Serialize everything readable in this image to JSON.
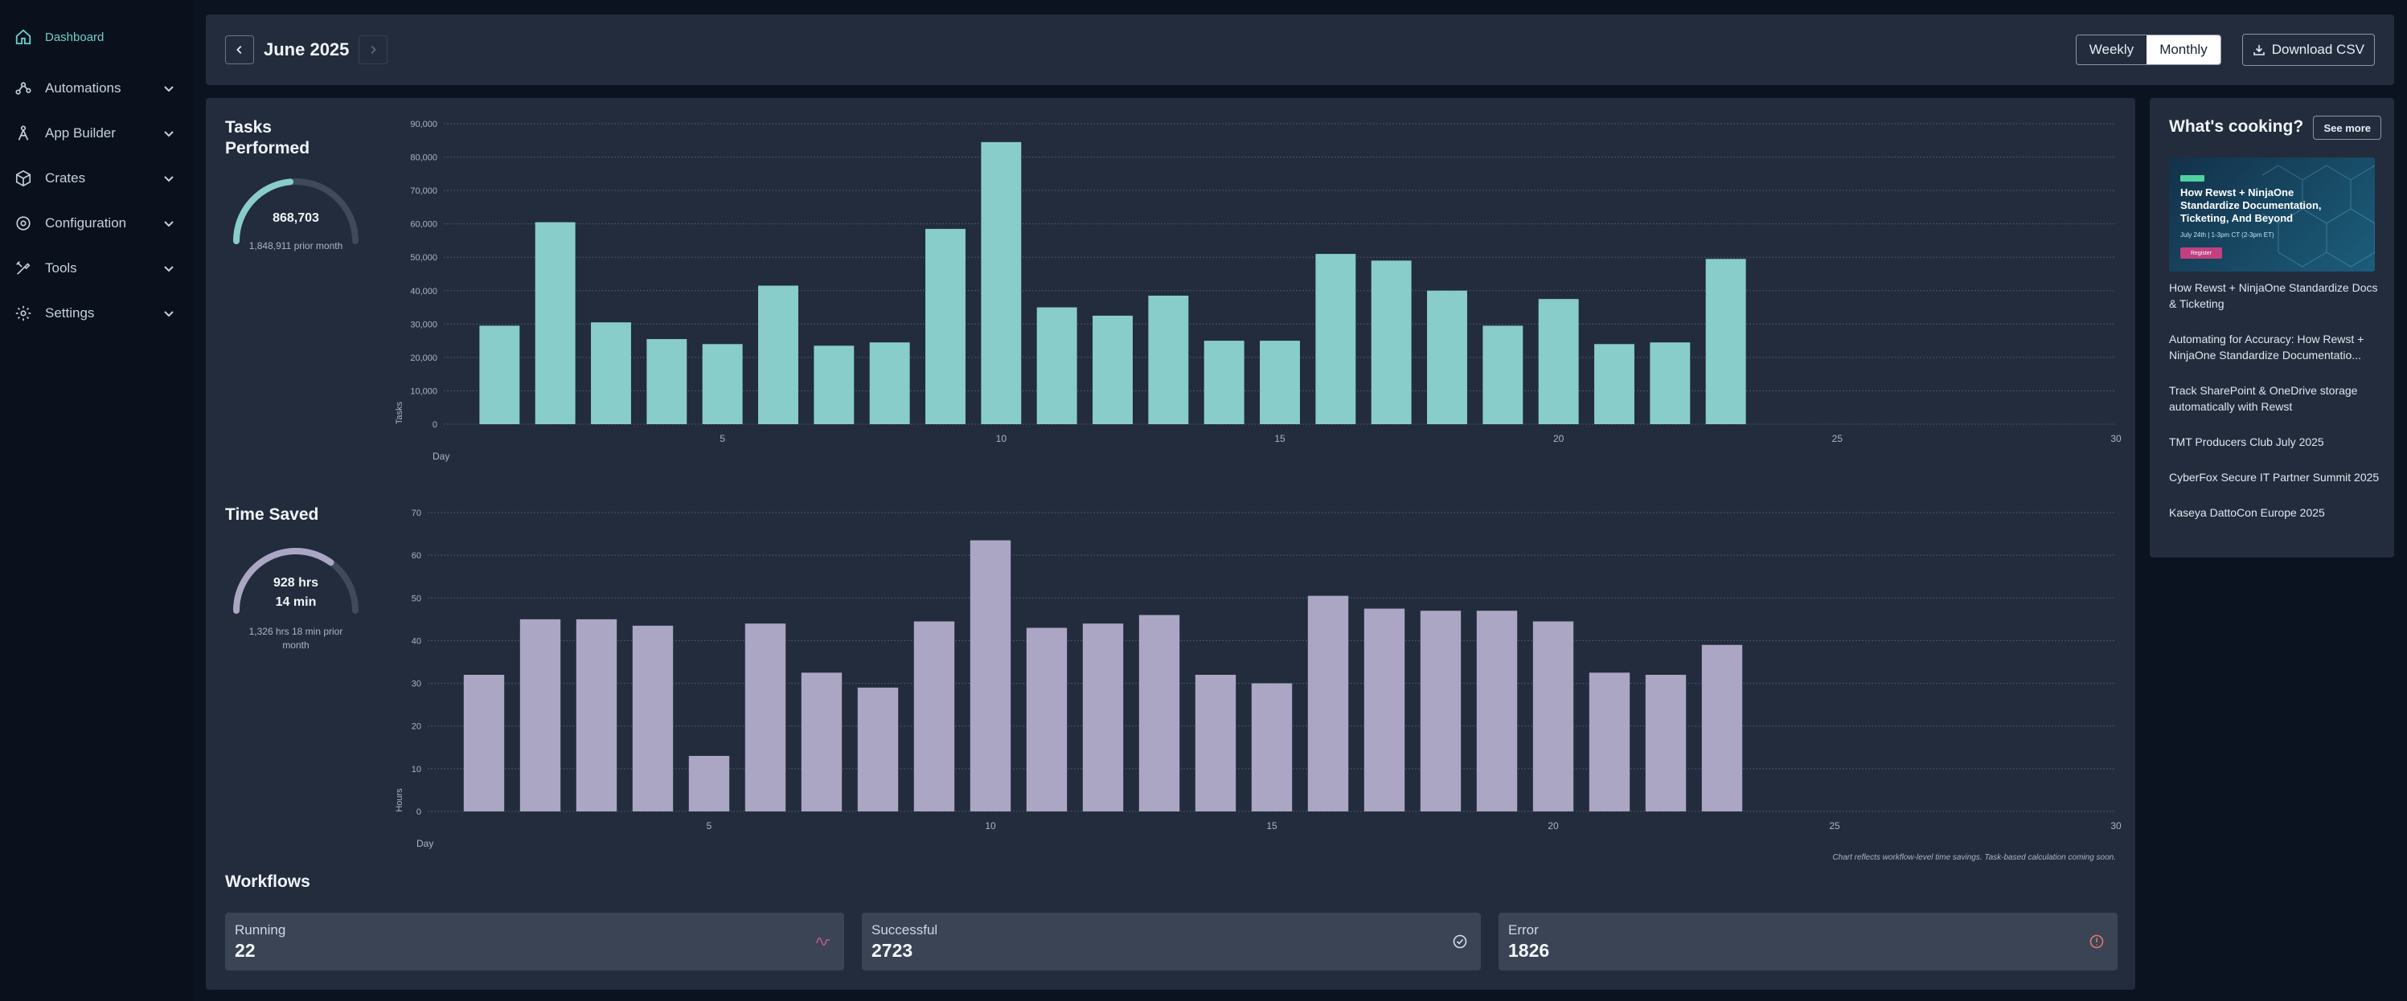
{
  "sidebar": {
    "items": [
      {
        "label": "Dashboard",
        "icon": "home-icon",
        "active": true,
        "has_chevron": false
      },
      {
        "label": "Automations",
        "icon": "automations-icon",
        "has_chevron": true
      },
      {
        "label": "App Builder",
        "icon": "app-builder-icon",
        "has_chevron": true
      },
      {
        "label": "Crates",
        "icon": "crates-icon",
        "has_chevron": true
      },
      {
        "label": "Configuration",
        "icon": "configuration-icon",
        "has_chevron": true
      },
      {
        "label": "Tools",
        "icon": "tools-icon",
        "has_chevron": true
      },
      {
        "label": "Settings",
        "icon": "settings-icon",
        "has_chevron": true
      }
    ]
  },
  "topbar": {
    "month": "June 2025",
    "weekly_label": "Weekly",
    "monthly_label": "Monthly",
    "active_view": "Monthly",
    "download_label": "Download CSV"
  },
  "tasks": {
    "title": "Tasks Performed",
    "value": "868,703",
    "prior": "1,848,911 prior month",
    "gauge_fraction": 0.47,
    "color": "#88cdc9"
  },
  "time_saved": {
    "title": "Time Saved",
    "value_line1": "928 hrs",
    "value_line2": "14 min",
    "prior": "1,326 hrs 18 min prior month",
    "gauge_fraction": 0.7,
    "color": "#aba6c4"
  },
  "chart_data": [
    {
      "type": "bar",
      "title": "",
      "xlabel": "Day",
      "ylabel": "Tasks",
      "x": [
        1,
        2,
        3,
        4,
        5,
        6,
        7,
        8,
        9,
        10,
        11,
        12,
        13,
        14,
        15,
        16,
        17,
        18,
        19,
        20,
        21,
        22,
        23
      ],
      "values": [
        29500,
        60500,
        30500,
        25500,
        24000,
        41500,
        23500,
        24500,
        58500,
        84500,
        35000,
        32500,
        38500,
        25000,
        25000,
        51000,
        49000,
        40000,
        29500,
        37500,
        24000,
        24500,
        49500
      ],
      "xlim": [
        0,
        30
      ],
      "ylim": [
        0,
        90000
      ],
      "x_ticks": [
        5,
        10,
        15,
        20,
        25,
        30
      ],
      "y_ticks": [
        0,
        10000,
        20000,
        30000,
        40000,
        50000,
        60000,
        70000,
        80000,
        90000
      ],
      "y_tick_labels": [
        "0",
        "10,000",
        "20,000",
        "30,000",
        "40,000",
        "50,000",
        "60,000",
        "70,000",
        "80,000",
        "90,000"
      ],
      "grid": true,
      "color": "#88cdc9"
    },
    {
      "type": "bar",
      "title": "",
      "xlabel": "Day",
      "ylabel": "Hours",
      "x": [
        1,
        2,
        3,
        4,
        5,
        6,
        7,
        8,
        9,
        10,
        11,
        12,
        13,
        14,
        15,
        16,
        17,
        18,
        19,
        20,
        21,
        22,
        23
      ],
      "values": [
        32,
        45,
        45,
        43.5,
        13,
        44,
        32.5,
        29,
        44.5,
        63.5,
        43,
        44,
        46,
        32,
        30,
        50.5,
        47.5,
        47,
        47,
        44.5,
        32.5,
        32,
        39
      ],
      "xlim": [
        0,
        30
      ],
      "ylim": [
        0,
        70
      ],
      "x_ticks": [
        5,
        10,
        15,
        20,
        25,
        30
      ],
      "y_ticks": [
        0,
        10,
        20,
        30,
        40,
        50,
        60,
        70
      ],
      "y_tick_labels": [
        "0",
        "10",
        "20",
        "30",
        "40",
        "50",
        "60",
        "70"
      ],
      "grid": true,
      "color": "#aba6c4"
    }
  ],
  "chart_note": "Chart reflects workflow-level time savings. Task-based calculation coming soon.",
  "workflows": {
    "title": "Workflows",
    "cards": [
      {
        "label": "Running",
        "value": "22",
        "icon": "activity-icon",
        "color": "#c25a86"
      },
      {
        "label": "Successful",
        "value": "2723",
        "icon": "check-circle-icon",
        "color": "#d6dde8"
      },
      {
        "label": "Error",
        "value": "1826",
        "icon": "alert-circle-icon",
        "color": "#e07a6a"
      }
    ]
  },
  "whats_cooking": {
    "title": "What's cooking?",
    "see_more": "See more",
    "banner_title": "How Rewst + NinjaOne Standardize Documentation, Ticketing, And Beyond",
    "banner_sub": "July 24th | 1-3pm CT (2-3pm ET)",
    "banner_button": "Register",
    "items": [
      "How Rewst + NinjaOne Standardize Docs & Ticketing",
      "Automating for Accuracy: How Rewst + NinjaOne Standardize Documentatio...",
      "Track SharePoint & OneDrive storage automatically with Rewst",
      "TMT Producers Club July 2025",
      "CyberFox Secure IT Partner Summit 2025",
      "Kaseya DattoCon Europe 2025"
    ]
  }
}
